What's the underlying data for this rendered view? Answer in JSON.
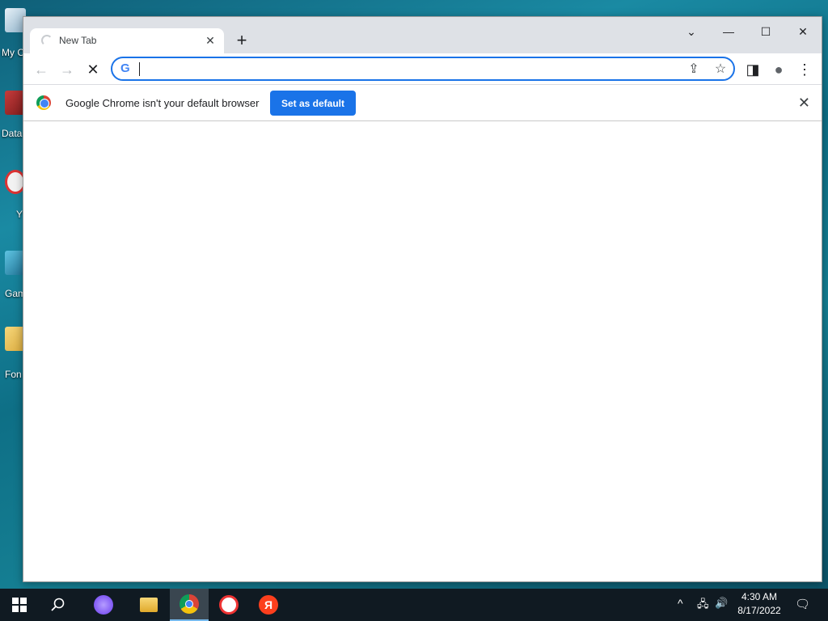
{
  "desktop": {
    "icons": [
      {
        "label": "My C"
      },
      {
        "label": "Data"
      },
      {
        "label": "Y"
      },
      {
        "label": "Gam"
      },
      {
        "label": "Fon"
      }
    ]
  },
  "browser": {
    "tab": {
      "title": "New Tab",
      "close": "✕"
    },
    "new_tab": "+",
    "window_controls": {
      "dropdown": "⌄",
      "minimize": "—",
      "maximize": "☐",
      "close": "✕"
    },
    "toolbar": {
      "back": "←",
      "forward": "→",
      "stop": "✕",
      "omnibox_value": "",
      "omnibox_placeholder": "",
      "google_g": "G",
      "share": "⇪",
      "bookmark": "☆",
      "side_panel": "◨",
      "profile": "●",
      "menu": "⋮"
    },
    "infobar": {
      "message": "Google Chrome isn't your default browser",
      "button": "Set as default",
      "close": "✕"
    }
  },
  "taskbar": {
    "clock_time": "4:30 AM",
    "clock_date": "8/17/2022",
    "tray": {
      "chevron": "^",
      "network": "🖧",
      "volume": "🔊",
      "notifications": "🗨"
    }
  }
}
